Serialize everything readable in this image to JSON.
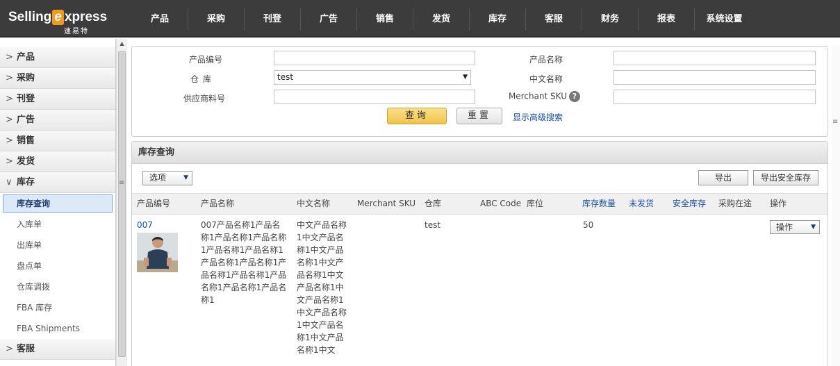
{
  "logo": {
    "brand_pre": "Selling",
    "brand_x": "e",
    "brand_post": "xpress",
    "sub": "速易特"
  },
  "nav": [
    "产品",
    "采购",
    "刊登",
    "广告",
    "销售",
    "发货",
    "库存",
    "客服",
    "财务",
    "报表",
    "系统设置"
  ],
  "sidebar": {
    "groups_top": [
      "产品",
      "采购",
      "刊登",
      "广告",
      "销售",
      "发货"
    ],
    "open_group": "库存",
    "sub_items": [
      "库存查询",
      "入库单",
      "出库单",
      "盘点单",
      "仓库调拨",
      "FBA 库存",
      "FBA Shipments"
    ],
    "groups_bottom": [
      "客服"
    ]
  },
  "search": {
    "product_code_label": "产品编号",
    "product_code_value": "",
    "product_name_label": "产品名称",
    "product_name_value": "",
    "warehouse_label": "仓库",
    "warehouse_value": "test",
    "cn_name_label": "中文名称",
    "cn_name_value": "",
    "supplier_code_label": "供应商料号",
    "supplier_code_value": "",
    "merchant_sku_label": "Merchant SKU",
    "merchant_sku_value": "",
    "help_glyph": "?",
    "query_button": "查询",
    "reset_button": "重置",
    "advanced_link": "显示高级搜索"
  },
  "results": {
    "title": "库存查询",
    "options_label": "选项",
    "export_button": "导出",
    "export_safe_button": "导出安全库存",
    "columns": [
      "产品编号",
      "产品名称",
      "中文名称",
      "Merchant SKU",
      "仓库",
      "ABC Code",
      "库位",
      "库存数量",
      "未发货",
      "安全库存",
      "采购在途",
      "操作"
    ],
    "rows": [
      {
        "product_code": "007",
        "product_name": "007产品名称1产品名称1产品名称1产品名称1产品名称1产品名称1产品名称1产品名称1产品名称1产品名称1产品名称1产品名称1产品名称1",
        "cn_name": "中文产品名称1中文产品名称1中文产品名称1中文产品名称1中文产品名称1中文产品名称1中文产品名称1中文产品名称1中文产品名称1中文",
        "merchant_sku": "",
        "warehouse": "test",
        "abc_code": "",
        "location": "",
        "stock_qty": "50",
        "unshipped": "",
        "safety_stock": "",
        "in_transit": "",
        "action_label": "操作"
      }
    ]
  }
}
